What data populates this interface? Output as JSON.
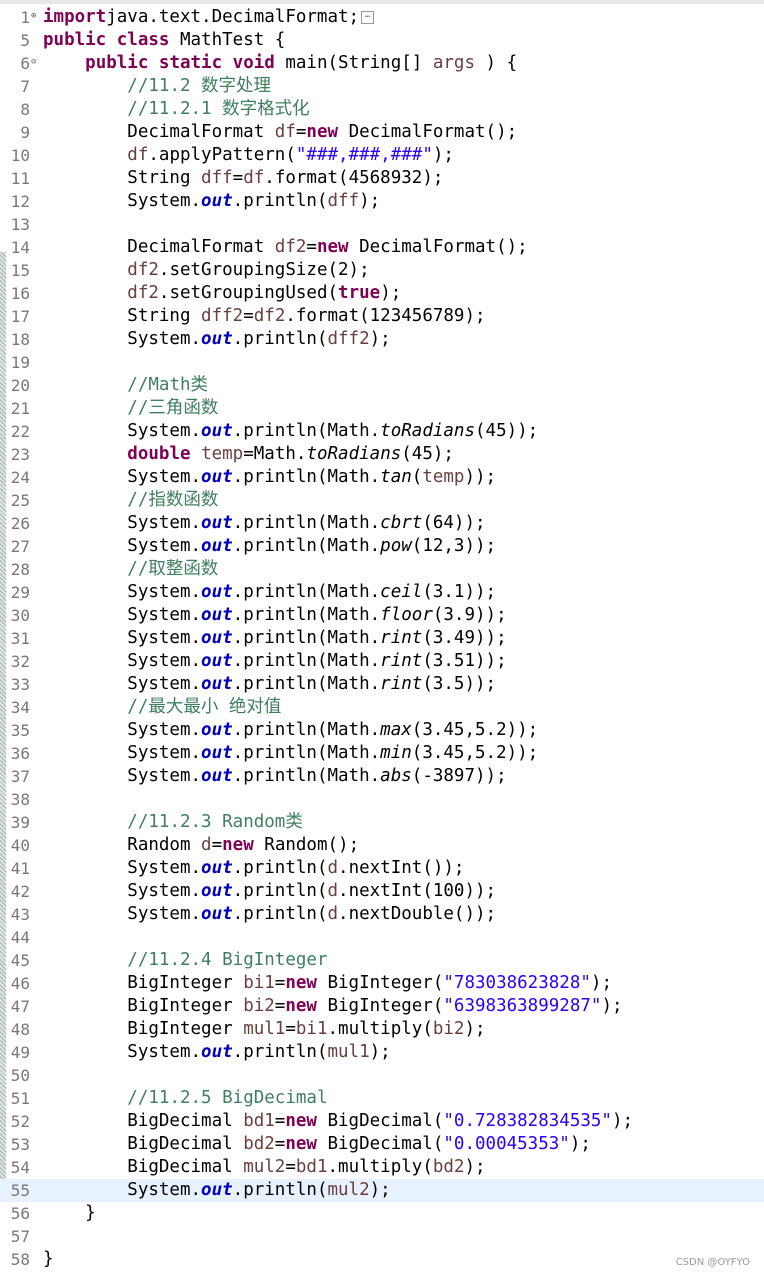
{
  "editor": {
    "watermark": "CSDN @OYFYO",
    "current_line": 55,
    "lines": [
      {
        "n": "1",
        "fold": "plus",
        "t": [
          [
            "kw",
            "import"
          ],
          [
            "",
            "java.text.DecimalFormat;"
          ]
        ],
        "folded": true
      },
      {
        "n": "5",
        "t": [
          [
            "kw",
            "public class"
          ],
          [
            "",
            " MathTest {"
          ]
        ]
      },
      {
        "n": "6",
        "fold": "minus",
        "t": [
          [
            "",
            "    "
          ],
          [
            "kw",
            "public static void"
          ],
          [
            "",
            " main(String[] "
          ],
          [
            "var",
            "args"
          ],
          [
            "",
            " ) {"
          ]
        ]
      },
      {
        "n": "7",
        "t": [
          [
            "",
            "        "
          ],
          [
            "cm",
            "//11.2 数字处理"
          ]
        ]
      },
      {
        "n": "8",
        "t": [
          [
            "",
            "        "
          ],
          [
            "cm",
            "//11.2.1 数字格式化"
          ]
        ]
      },
      {
        "n": "9",
        "t": [
          [
            "",
            "        DecimalFormat "
          ],
          [
            "var",
            "df"
          ],
          [
            "",
            "="
          ],
          [
            "kw",
            "new"
          ],
          [
            "",
            " DecimalFormat();"
          ]
        ]
      },
      {
        "n": "10",
        "t": [
          [
            "",
            "        "
          ],
          [
            "var",
            "df"
          ],
          [
            "",
            ".applyPattern("
          ],
          [
            "st",
            "\"###,###,###\""
          ],
          [
            "",
            ");"
          ]
        ]
      },
      {
        "n": "11",
        "t": [
          [
            "",
            "        String "
          ],
          [
            "var",
            "dff"
          ],
          [
            "",
            "="
          ],
          [
            "var",
            "df"
          ],
          [
            "",
            ".format(4568932);"
          ]
        ]
      },
      {
        "n": "12",
        "t": [
          [
            "",
            "        System."
          ],
          [
            "fld",
            "out"
          ],
          [
            "",
            ".println("
          ],
          [
            "var",
            "dff"
          ],
          [
            "",
            ");"
          ]
        ]
      },
      {
        "n": "13",
        "t": []
      },
      {
        "n": "14",
        "t": [
          [
            "",
            "        DecimalFormat "
          ],
          [
            "var",
            "df2"
          ],
          [
            "",
            "="
          ],
          [
            "kw",
            "new"
          ],
          [
            "",
            " DecimalFormat();"
          ]
        ]
      },
      {
        "n": "15",
        "t": [
          [
            "",
            "        "
          ],
          [
            "var",
            "df2"
          ],
          [
            "",
            ".setGroupingSize(2);"
          ]
        ]
      },
      {
        "n": "16",
        "t": [
          [
            "",
            "        "
          ],
          [
            "var",
            "df2"
          ],
          [
            "",
            ".setGroupingUsed("
          ],
          [
            "kw",
            "true"
          ],
          [
            "",
            ");"
          ]
        ]
      },
      {
        "n": "17",
        "t": [
          [
            "",
            "        String "
          ],
          [
            "var",
            "dff2"
          ],
          [
            "",
            "="
          ],
          [
            "var",
            "df2"
          ],
          [
            "",
            ".format(123456789);"
          ]
        ]
      },
      {
        "n": "18",
        "t": [
          [
            "",
            "        System."
          ],
          [
            "fld",
            "out"
          ],
          [
            "",
            ".println("
          ],
          [
            "var",
            "dff2"
          ],
          [
            "",
            ");"
          ]
        ]
      },
      {
        "n": "19",
        "t": []
      },
      {
        "n": "20",
        "t": [
          [
            "",
            "        "
          ],
          [
            "cm",
            "//Math类"
          ]
        ]
      },
      {
        "n": "21",
        "t": [
          [
            "",
            "        "
          ],
          [
            "cm",
            "//三角函数"
          ]
        ]
      },
      {
        "n": "22",
        "t": [
          [
            "",
            "        System."
          ],
          [
            "fld",
            "out"
          ],
          [
            "",
            ".println(Math."
          ],
          [
            "st-m",
            "toRadians"
          ],
          [
            "",
            "(45));"
          ]
        ]
      },
      {
        "n": "23",
        "t": [
          [
            "",
            "        "
          ],
          [
            "kw",
            "double"
          ],
          [
            "",
            " "
          ],
          [
            "var",
            "temp"
          ],
          [
            "",
            "=Math."
          ],
          [
            "st-m",
            "toRadians"
          ],
          [
            "",
            "(45);"
          ]
        ]
      },
      {
        "n": "24",
        "t": [
          [
            "",
            "        System."
          ],
          [
            "fld",
            "out"
          ],
          [
            "",
            ".println(Math."
          ],
          [
            "st-m",
            "tan"
          ],
          [
            "",
            "("
          ],
          [
            "var",
            "temp"
          ],
          [
            "",
            "));"
          ]
        ]
      },
      {
        "n": "25",
        "t": [
          [
            "",
            "        "
          ],
          [
            "cm",
            "//指数函数"
          ]
        ]
      },
      {
        "n": "26",
        "t": [
          [
            "",
            "        System."
          ],
          [
            "fld",
            "out"
          ],
          [
            "",
            ".println(Math."
          ],
          [
            "st-m",
            "cbrt"
          ],
          [
            "",
            "(64));"
          ]
        ]
      },
      {
        "n": "27",
        "t": [
          [
            "",
            "        System."
          ],
          [
            "fld",
            "out"
          ],
          [
            "",
            ".println(Math."
          ],
          [
            "st-m",
            "pow"
          ],
          [
            "",
            "(12,3));"
          ]
        ]
      },
      {
        "n": "28",
        "t": [
          [
            "",
            "        "
          ],
          [
            "cm",
            "//取整函数"
          ]
        ]
      },
      {
        "n": "29",
        "t": [
          [
            "",
            "        System."
          ],
          [
            "fld",
            "out"
          ],
          [
            "",
            ".println(Math."
          ],
          [
            "st-m",
            "ceil"
          ],
          [
            "",
            "(3.1));"
          ]
        ]
      },
      {
        "n": "30",
        "t": [
          [
            "",
            "        System."
          ],
          [
            "fld",
            "out"
          ],
          [
            "",
            ".println(Math."
          ],
          [
            "st-m",
            "floor"
          ],
          [
            "",
            "(3.9));"
          ]
        ]
      },
      {
        "n": "31",
        "t": [
          [
            "",
            "        System."
          ],
          [
            "fld",
            "out"
          ],
          [
            "",
            ".println(Math."
          ],
          [
            "st-m",
            "rint"
          ],
          [
            "",
            "(3.49));"
          ]
        ]
      },
      {
        "n": "32",
        "t": [
          [
            "",
            "        System."
          ],
          [
            "fld",
            "out"
          ],
          [
            "",
            ".println(Math."
          ],
          [
            "st-m",
            "rint"
          ],
          [
            "",
            "(3.51));"
          ]
        ]
      },
      {
        "n": "33",
        "t": [
          [
            "",
            "        System."
          ],
          [
            "fld",
            "out"
          ],
          [
            "",
            ".println(Math."
          ],
          [
            "st-m",
            "rint"
          ],
          [
            "",
            "(3.5));"
          ]
        ]
      },
      {
        "n": "34",
        "t": [
          [
            "",
            "        "
          ],
          [
            "cm",
            "//最大最小 绝对值"
          ]
        ]
      },
      {
        "n": "35",
        "t": [
          [
            "",
            "        System."
          ],
          [
            "fld",
            "out"
          ],
          [
            "",
            ".println(Math."
          ],
          [
            "st-m",
            "max"
          ],
          [
            "",
            "(3.45,5.2));"
          ]
        ]
      },
      {
        "n": "36",
        "t": [
          [
            "",
            "        System."
          ],
          [
            "fld",
            "out"
          ],
          [
            "",
            ".println(Math."
          ],
          [
            "st-m",
            "min"
          ],
          [
            "",
            "(3.45,5.2));"
          ]
        ]
      },
      {
        "n": "37",
        "t": [
          [
            "",
            "        System."
          ],
          [
            "fld",
            "out"
          ],
          [
            "",
            ".println(Math."
          ],
          [
            "st-m",
            "abs"
          ],
          [
            "",
            "(-3897));"
          ]
        ]
      },
      {
        "n": "38",
        "t": []
      },
      {
        "n": "39",
        "t": [
          [
            "",
            "        "
          ],
          [
            "cm",
            "//11.2.3 Random类"
          ]
        ]
      },
      {
        "n": "40",
        "t": [
          [
            "",
            "        Random "
          ],
          [
            "var",
            "d"
          ],
          [
            "",
            "="
          ],
          [
            "kw",
            "new"
          ],
          [
            "",
            " Random();"
          ]
        ]
      },
      {
        "n": "41",
        "t": [
          [
            "",
            "        System."
          ],
          [
            "fld",
            "out"
          ],
          [
            "",
            ".println("
          ],
          [
            "var",
            "d"
          ],
          [
            "",
            ".nextInt());"
          ]
        ]
      },
      {
        "n": "42",
        "t": [
          [
            "",
            "        System."
          ],
          [
            "fld",
            "out"
          ],
          [
            "",
            ".println("
          ],
          [
            "var",
            "d"
          ],
          [
            "",
            ".nextInt(100));"
          ]
        ]
      },
      {
        "n": "43",
        "t": [
          [
            "",
            "        System."
          ],
          [
            "fld",
            "out"
          ],
          [
            "",
            ".println("
          ],
          [
            "var",
            "d"
          ],
          [
            "",
            ".nextDouble());"
          ]
        ]
      },
      {
        "n": "44",
        "t": []
      },
      {
        "n": "45",
        "t": [
          [
            "",
            "        "
          ],
          [
            "cm",
            "//11.2.4 BigInteger"
          ]
        ]
      },
      {
        "n": "46",
        "t": [
          [
            "",
            "        BigInteger "
          ],
          [
            "var",
            "bi1"
          ],
          [
            "",
            "="
          ],
          [
            "kw",
            "new"
          ],
          [
            "",
            " BigInteger("
          ],
          [
            "st",
            "\"783038623828\""
          ],
          [
            "",
            ");"
          ]
        ]
      },
      {
        "n": "47",
        "t": [
          [
            "",
            "        BigInteger "
          ],
          [
            "var",
            "bi2"
          ],
          [
            "",
            "="
          ],
          [
            "kw",
            "new"
          ],
          [
            "",
            " BigInteger("
          ],
          [
            "st",
            "\"6398363899287\""
          ],
          [
            "",
            ");"
          ]
        ]
      },
      {
        "n": "48",
        "t": [
          [
            "",
            "        BigInteger "
          ],
          [
            "var",
            "mul1"
          ],
          [
            "",
            "="
          ],
          [
            "var",
            "bi1"
          ],
          [
            "",
            ".multiply("
          ],
          [
            "var",
            "bi2"
          ],
          [
            "",
            ");"
          ]
        ]
      },
      {
        "n": "49",
        "t": [
          [
            "",
            "        System."
          ],
          [
            "fld",
            "out"
          ],
          [
            "",
            ".println("
          ],
          [
            "var",
            "mul1"
          ],
          [
            "",
            ");"
          ]
        ]
      },
      {
        "n": "50",
        "t": []
      },
      {
        "n": "51",
        "t": [
          [
            "",
            "        "
          ],
          [
            "cm",
            "//11.2.5 BigDecimal"
          ]
        ]
      },
      {
        "n": "52",
        "t": [
          [
            "",
            "        BigDecimal "
          ],
          [
            "var",
            "bd1"
          ],
          [
            "",
            "="
          ],
          [
            "kw",
            "new"
          ],
          [
            "",
            " BigDecimal("
          ],
          [
            "st",
            "\"0.728382834535\""
          ],
          [
            "",
            ");"
          ]
        ]
      },
      {
        "n": "53",
        "t": [
          [
            "",
            "        BigDecimal "
          ],
          [
            "var",
            "bd2"
          ],
          [
            "",
            "="
          ],
          [
            "kw",
            "new"
          ],
          [
            "",
            " BigDecimal("
          ],
          [
            "st",
            "\"0.00045353\""
          ],
          [
            "",
            ");"
          ]
        ]
      },
      {
        "n": "54",
        "t": [
          [
            "",
            "        BigDecimal "
          ],
          [
            "var",
            "mul2"
          ],
          [
            "",
            "="
          ],
          [
            "var",
            "bd1"
          ],
          [
            "",
            ".multiply("
          ],
          [
            "var",
            "bd2"
          ],
          [
            "",
            ");"
          ]
        ]
      },
      {
        "n": "55",
        "t": [
          [
            "",
            "        System."
          ],
          [
            "fld",
            "out"
          ],
          [
            "",
            ".println("
          ],
          [
            "var",
            "mul2"
          ],
          [
            "",
            ");"
          ]
        ]
      },
      {
        "n": "56",
        "t": [
          [
            "",
            "    }"
          ]
        ]
      },
      {
        "n": "57",
        "t": []
      },
      {
        "n": "58",
        "t": [
          [
            "",
            "}"
          ]
        ]
      }
    ]
  }
}
